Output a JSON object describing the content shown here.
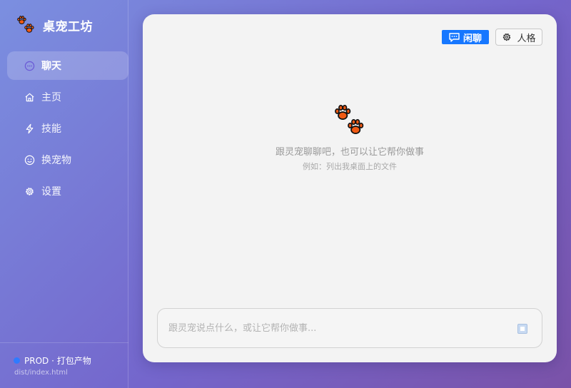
{
  "brand": {
    "name": "桌宠工坊",
    "logo_icon": "paw-icon"
  },
  "nav": {
    "items": [
      {
        "label": "聊天",
        "icon": "chat-bubble-icon",
        "active": true
      },
      {
        "label": "主页",
        "icon": "home-icon",
        "active": false
      },
      {
        "label": "技能",
        "icon": "lightning-icon",
        "active": false
      },
      {
        "label": "换宠物",
        "icon": "smile-icon",
        "active": false
      },
      {
        "label": "设置",
        "icon": "gear-icon",
        "active": false
      }
    ]
  },
  "footer": {
    "env_label": "PROD · 打包产物",
    "path": "dist/index.html",
    "env_color": "#2f7bff"
  },
  "chat": {
    "mode_badge": "闲聊",
    "persona_button": "人格",
    "empty_hint": "跟灵宠聊聊吧，也可以让它帮你做事",
    "example_hint": "例如：列出我桌面上的文件",
    "input_placeholder": "跟灵宠说点什么，或让它帮你做事..."
  },
  "colors": {
    "accent": "#1677ff",
    "paw": "#f05a14"
  }
}
